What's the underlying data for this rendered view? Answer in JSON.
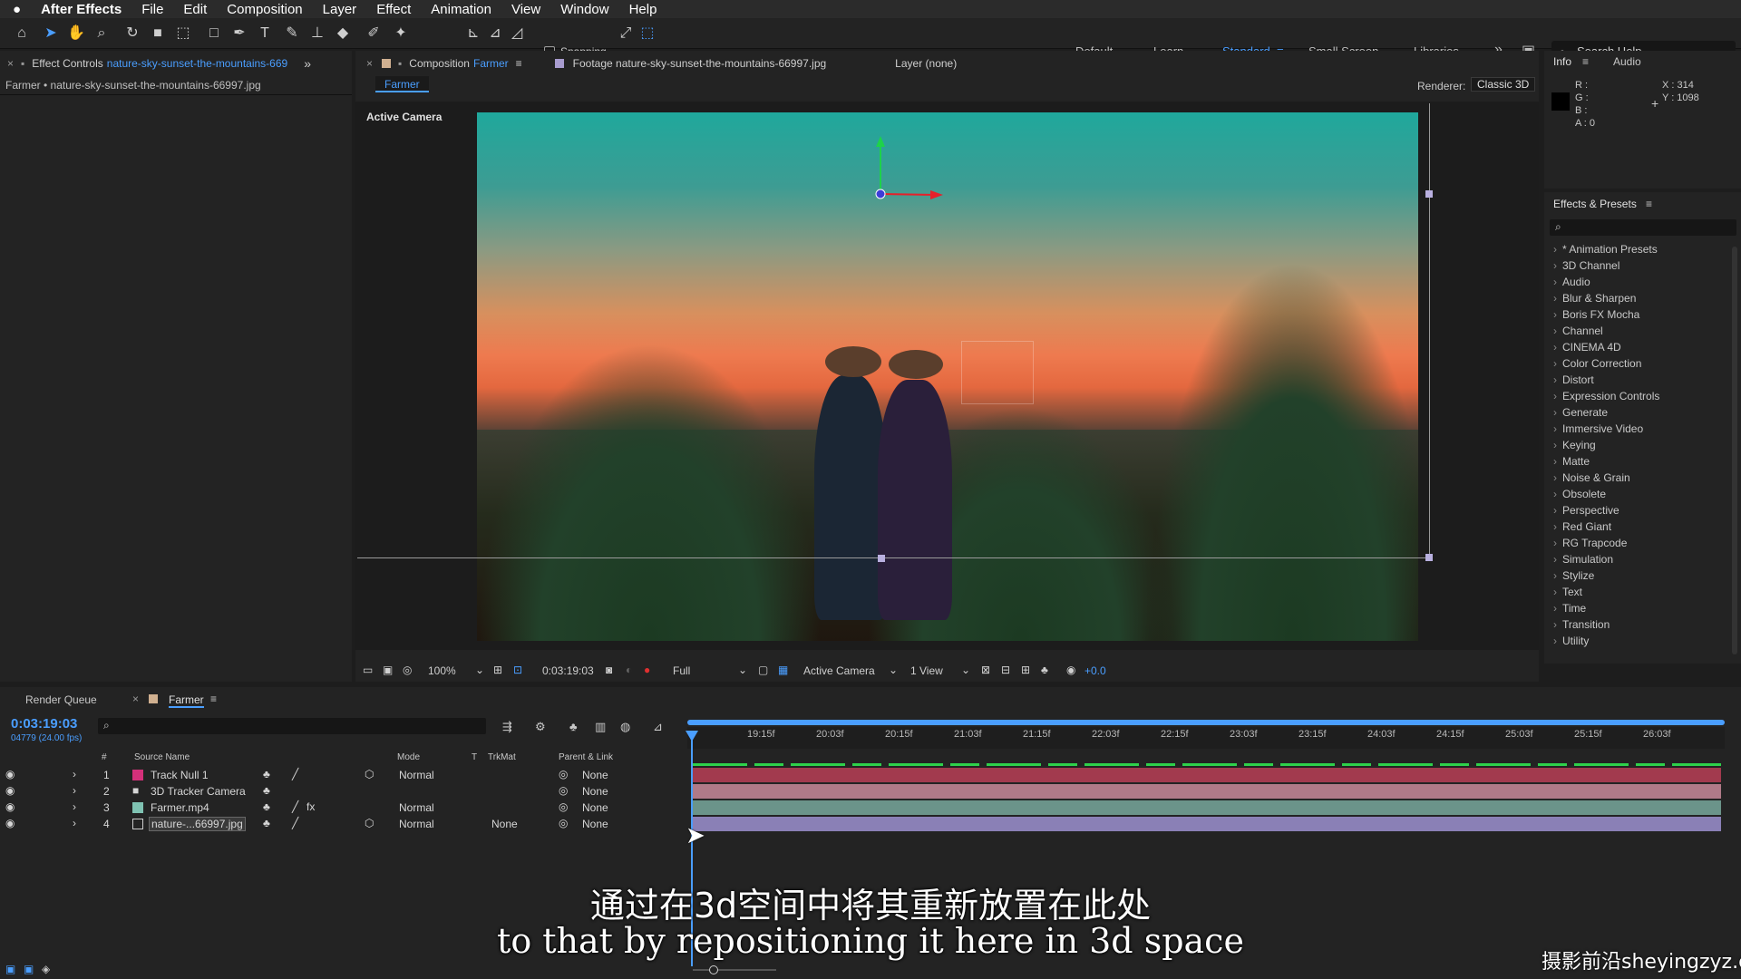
{
  "menubar": {
    "app": "After Effects",
    "items": [
      "File",
      "Edit",
      "Composition",
      "Layer",
      "Effect",
      "Animation",
      "View",
      "Window",
      "Help"
    ]
  },
  "toolbar": {
    "snapping": "Snapping",
    "workspaces": [
      "Default",
      "Learn",
      "Standard",
      "Small Screen",
      "Libraries"
    ],
    "search_placeholder": "Search Help"
  },
  "effect_controls": {
    "tab_prefix": "Effect Controls",
    "tab_layer": "nature-sky-sunset-the-mountains-669",
    "breadcrumb": "Farmer • nature-sky-sunset-the-mountains-66997.jpg"
  },
  "composition": {
    "tab_prefix": "Composition",
    "tab_name": "Farmer",
    "subtab": "Farmer",
    "footage_tab": "Footage nature-sky-sunset-the-mountains-66997.jpg",
    "layer_tab": "Layer (none)",
    "renderer_label": "Renderer:",
    "renderer_value": "Classic 3D",
    "active_camera": "Active Camera"
  },
  "viewer_controls": {
    "zoom": "100%",
    "timecode": "0:03:19:03",
    "resolution": "Full",
    "camera": "Active Camera",
    "views": "1 View",
    "exposure": "+0.0"
  },
  "info": {
    "tab": "Info",
    "audio_tab": "Audio",
    "r": "R :",
    "g": "G :",
    "b": "B :",
    "a": "A : 0",
    "x": "X : 314",
    "y": "Y : 1098"
  },
  "effects_presets": {
    "title": "Effects & Presets",
    "items": [
      "* Animation Presets",
      "3D Channel",
      "Audio",
      "Blur & Sharpen",
      "Boris FX Mocha",
      "Channel",
      "CINEMA 4D",
      "Color Correction",
      "Distort",
      "Expression Controls",
      "Generate",
      "Immersive Video",
      "Keying",
      "Matte",
      "Noise & Grain",
      "Obsolete",
      "Perspective",
      "Red Giant",
      "RG Trapcode",
      "Simulation",
      "Stylize",
      "Text",
      "Time",
      "Transition",
      "Utility"
    ]
  },
  "timeline": {
    "render_queue": "Render Queue",
    "comp_tab": "Farmer",
    "timecode": "0:03:19:03",
    "frames": "04779 (24.00 fps)",
    "headers": {
      "num": "#",
      "source": "Source Name",
      "mode": "Mode",
      "t": "T",
      "trkmat": "TrkMat",
      "parent": "Parent & Link"
    },
    "ruler": [
      "19:15f",
      "20:03f",
      "20:15f",
      "21:03f",
      "21:15f",
      "22:03f",
      "22:15f",
      "23:03f",
      "23:15f",
      "24:03f",
      "24:15f",
      "25:03f",
      "25:15f",
      "26:03f"
    ],
    "layers": [
      {
        "num": "1",
        "name": "Track Null 1",
        "mode": "Normal",
        "trkmat": "",
        "parent": "None",
        "color": "#d4307a",
        "bar": "#a23a4e"
      },
      {
        "num": "2",
        "name": "3D Tracker Camera",
        "mode": "",
        "trkmat": "",
        "parent": "None",
        "color": "#e6a7c0",
        "bar": "#b07a88"
      },
      {
        "num": "3",
        "name": "Farmer.mp4",
        "mode": "Normal",
        "trkmat": "",
        "parent": "None",
        "color": "#7fc2b2",
        "bar": "#6b948a"
      },
      {
        "num": "4",
        "name": "nature-...66997.jpg",
        "mode": "Normal",
        "trkmat": "None",
        "parent": "None",
        "color": "#a89ccf",
        "bar": "#8a80b6"
      }
    ]
  },
  "subtitles": {
    "zh": "通过在3d空间中将其重新放置在此处",
    "en": "to that by repositioning it here in 3d space"
  },
  "watermark": "摄影前沿sheyingzyz.com"
}
